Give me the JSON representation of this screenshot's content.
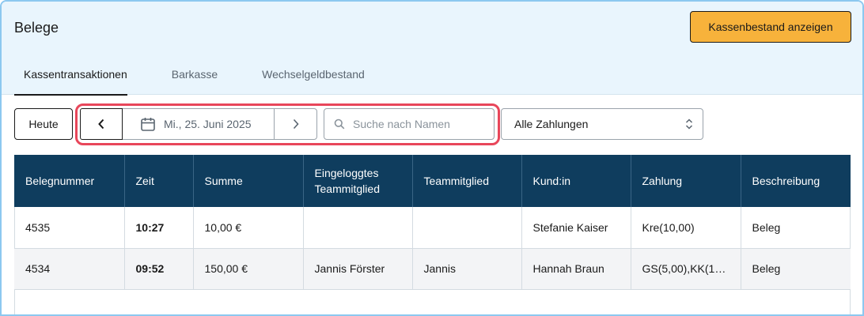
{
  "header": {
    "title": "Belege",
    "primary_button": "Kassenbestand anzeigen"
  },
  "tabs": [
    {
      "label": "Kassentransaktionen",
      "active": true
    },
    {
      "label": "Barkasse",
      "active": false
    },
    {
      "label": "Wechselgeldbestand",
      "active": false
    }
  ],
  "toolbar": {
    "today_label": "Heute",
    "date": "Mi., 25. Juni 2025",
    "search_placeholder": "Suche nach Namen",
    "payment_filter": "Alle Zahlungen"
  },
  "table": {
    "headers": [
      "Belegnummer",
      "Zeit",
      "Summe",
      "Eingeloggtes Teammitglied",
      "Teammitglied",
      "Kund:in",
      "Zahlung",
      "Beschreibung"
    ],
    "rows": [
      [
        "4535",
        "10:27",
        "10,00 €",
        "",
        "",
        "Stefanie Kaiser",
        "Kre(10,00)",
        "Beleg"
      ],
      [
        "4534",
        "09:52",
        "150,00 €",
        "Jannis Förster",
        "Jannis",
        "Hannah Braun",
        "GS(5,00),KK(14...",
        "Beleg"
      ]
    ]
  },
  "icons": {
    "prev": "chevron-left-icon",
    "next": "chevron-right-icon",
    "calendar": "calendar-icon",
    "search": "search-icon",
    "select": "sort-arrows-icon"
  },
  "colors": {
    "header_bg": "#e9f5fd",
    "primary": "#f7b23b",
    "table_header": "#0f3d5e",
    "highlight": "#e8465a"
  }
}
